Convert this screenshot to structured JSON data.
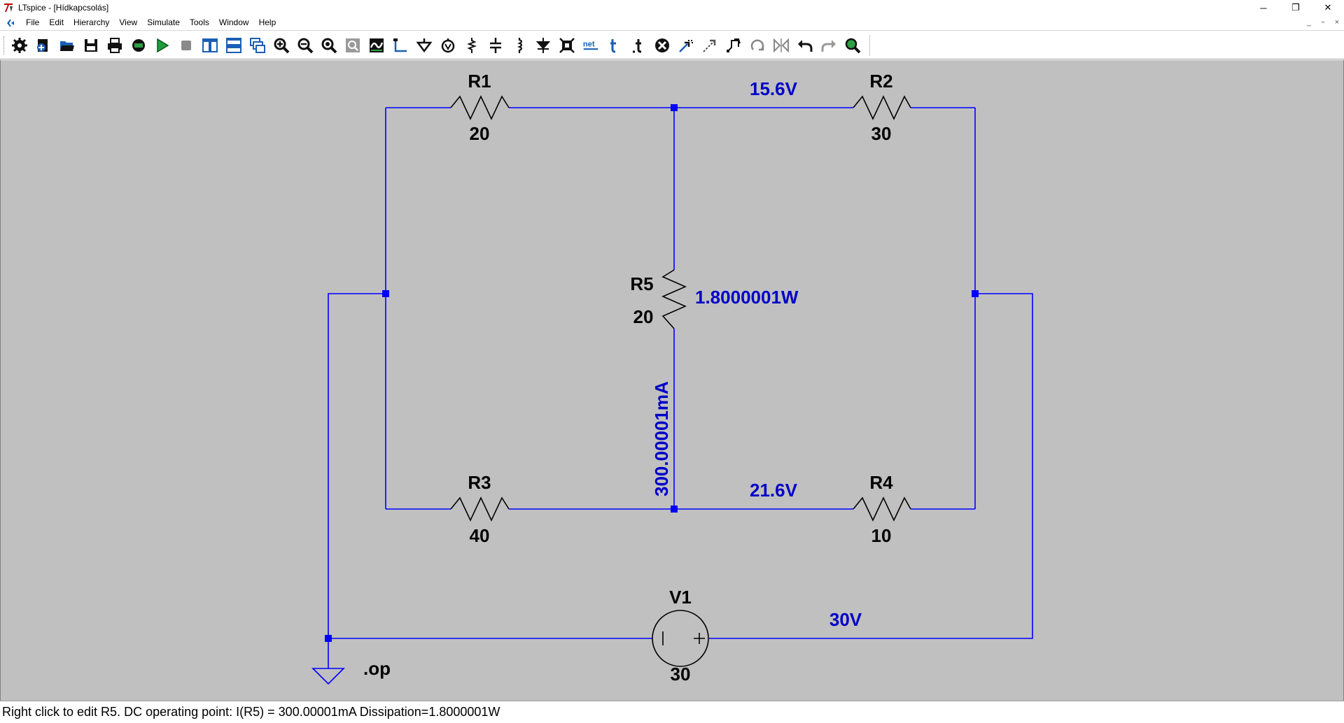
{
  "window": {
    "title": "LTspice - [Hídkapcsolás]",
    "controls": {
      "minimize": "─",
      "maximize": "❐",
      "close": "✕"
    },
    "mdi_controls": {
      "minimize": "_",
      "restore": "▫",
      "close": "×"
    }
  },
  "menu": [
    "File",
    "Edit",
    "Hierarchy",
    "View",
    "Simulate",
    "Tools",
    "Window",
    "Help"
  ],
  "toolbar": {
    "buttons": [
      "settings-icon",
      "new-schematic-icon",
      "open-icon",
      "save-icon",
      "print-icon",
      "control-panel-icon",
      "run-icon",
      "halt-icon",
      "tile-vertical-icon",
      "tile-horizontal-icon",
      "cascade-icon",
      "zoom-in-icon",
      "zoom-out-icon",
      "zoom-full-icon",
      "zoom-rect-icon",
      "autorange-icon",
      "wire-icon",
      "ground-icon",
      "voltage-source-icon",
      "resistor-icon",
      "capacitor-icon",
      "inductor-icon",
      "diode-icon",
      "component-icon",
      "label-net-icon",
      "text-icon",
      "spice-directive-icon",
      "delete-icon",
      "duplicate-icon",
      "move-icon",
      "drag-icon",
      "rotate-icon",
      "mirror-icon",
      "undo-icon",
      "redo-icon",
      "find-icon"
    ],
    "net_text": "net"
  },
  "schematic": {
    "components": [
      {
        "ref": "R1",
        "value": "20"
      },
      {
        "ref": "R2",
        "value": "30"
      },
      {
        "ref": "R3",
        "value": "40"
      },
      {
        "ref": "R4",
        "value": "10"
      },
      {
        "ref": "R5",
        "value": "20"
      },
      {
        "ref": "V1",
        "value": "30"
      }
    ],
    "annotations": {
      "top_node_voltage": "15.6V",
      "bottom_node_voltage": "21.6V",
      "source_voltage": "30V",
      "r5_power": "1.8000001W",
      "r5_current": "300.00001mA"
    },
    "directive": ".op",
    "colors": {
      "background": "#c0c0c0",
      "wire": "#0000ff",
      "annotation": "#0000c8",
      "component": "#000000"
    }
  },
  "status": {
    "text": "Right click to edit R5.  DC operating point: I(R5) = 300.00001mA   Dissipation=1.8000001W"
  }
}
